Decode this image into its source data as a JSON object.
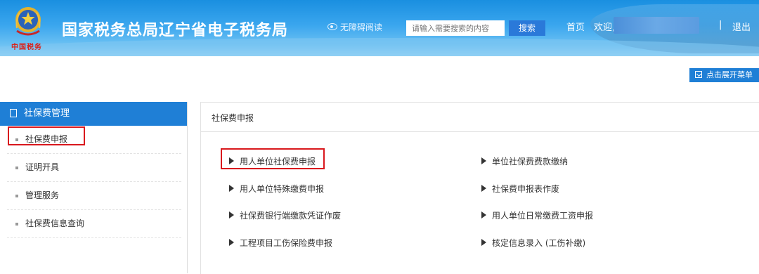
{
  "header": {
    "emblem_script": "中国税务",
    "title": "国家税务总局辽宁省电子税务局",
    "accessibility_label": "无障碍阅读",
    "search_placeholder": "请输入需要搜索的内容",
    "search_button": "搜索",
    "home": "首页",
    "welcome": "欢迎,",
    "separator": "|",
    "logout": "退出"
  },
  "expand_menu_label": "点击展开菜单",
  "sidebar": {
    "title": "社保费管理",
    "items": [
      {
        "label": "社保费申报"
      },
      {
        "label": "证明开具"
      },
      {
        "label": "管理服务"
      },
      {
        "label": "社保费信息查询"
      }
    ]
  },
  "main": {
    "title": "社保费申报",
    "links_left": [
      "用人单位社保费申报",
      "用人单位特殊缴费申报",
      "社保费银行端缴款凭证作废",
      "工程项目工伤保险费申报"
    ],
    "links_right": [
      "单位社保费费款缴纳",
      "社保费申报表作废",
      "用人单位日常缴费工资申报",
      "核定信息录入 (工伤补缴)"
    ]
  },
  "colors": {
    "header_blue": "#1a8fe0",
    "accent_blue": "#1f7fd6",
    "highlight_red": "#d9181d"
  }
}
